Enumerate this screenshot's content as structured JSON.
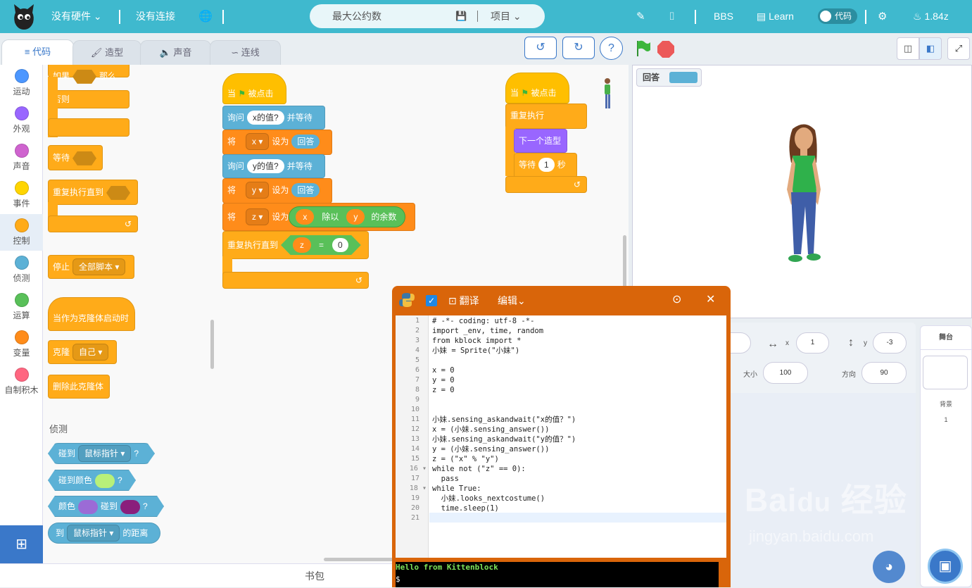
{
  "topbar": {
    "hardware": "没有硬件",
    "connection": "没有连接",
    "project_name": "最大公约数",
    "project_menu": "项目",
    "bbs": "BBS",
    "learn": "Learn",
    "code_toggle": "代码",
    "version": "1.84z"
  },
  "tabs": [
    "代码",
    "造型",
    "声音",
    "连线"
  ],
  "categories": [
    {
      "label": "运动",
      "color": "#4c97ff"
    },
    {
      "label": "外观",
      "color": "#9966ff"
    },
    {
      "label": "声音",
      "color": "#cf63cf"
    },
    {
      "label": "事件",
      "color": "#ffd500"
    },
    {
      "label": "控制",
      "color": "#ffab19"
    },
    {
      "label": "侦测",
      "color": "#5cb1d6"
    },
    {
      "label": "运算",
      "color": "#59c059"
    },
    {
      "label": "变量",
      "color": "#ff8c1a"
    },
    {
      "label": "自制积木",
      "color": "#ff6680"
    }
  ],
  "palette": {
    "if_then": "如果",
    "then": "那么",
    "else": "否则",
    "wait": "等待",
    "repeat_until": "重复执行直到",
    "stop": "停止",
    "stop_all": "全部脚本",
    "when_clone": "当作为克隆体启动时",
    "clone": "克隆",
    "clone_self": "自己",
    "delete_clone": "删除此克隆体",
    "sensing_header": "侦测",
    "touching": "碰到",
    "mouse_pointer": "鼠标指针",
    "touching_color": "碰到颜色",
    "color": "颜色",
    "touch": "碰到",
    "distance_to": "到",
    "distance": "的距离",
    "q": "?"
  },
  "script1": {
    "when": "当",
    "clicked": "被点击",
    "ask": "询问",
    "ask_x": "x的值?",
    "and_wait": "并等待",
    "set": "将",
    "var_x": "x",
    "set_to": "设为",
    "answer": "回答",
    "ask_y": "y的值?",
    "var_y": "y",
    "var_z": "z",
    "mod": "除以",
    "remainder": "的余数",
    "repeat_until": "重复执行直到",
    "eq": "=",
    "zero": "0"
  },
  "script2": {
    "when": "当",
    "clicked": "被点击",
    "forever": "重复执行",
    "next_costume": "下一个造型",
    "wait": "等待",
    "one": "1",
    "sec": "秒"
  },
  "stage": {
    "answer_monitor": "回答"
  },
  "sprite_info": {
    "x_label": "x",
    "x_value": "1",
    "y_label": "y",
    "y_value": "-3",
    "size_label": "大小",
    "size_value": "100",
    "direction_label": "方向",
    "direction_value": "90"
  },
  "stage_panel": {
    "title": "舞台",
    "backdrops": "背景",
    "count": "1"
  },
  "bottombar": {
    "backpack": "书包"
  },
  "python": {
    "translate": "翻译",
    "edit": "编辑",
    "lines": [
      "# -*- coding: utf-8 -*-",
      "import _env, time, random",
      "from kblock import *",
      "小妹 = Sprite(\"小妹\")",
      "",
      "x = 0",
      "y = 0",
      "z = 0",
      "",
      "",
      "小妹.sensing_askandwait(\"x的值？\")",
      "x = (小妹.sensing_answer())",
      "小妹.sensing_askandwait(\"y的值？\")",
      "y = (小妹.sensing_answer())",
      "z = (\"x\" % \"y\")",
      "while not (\"z\" == 0):",
      "  pass",
      "while True:",
      "  小妹.looks_nextcostume()",
      "  time.sleep(1)",
      ""
    ],
    "console_line": "Hello from Kittenblock",
    "prompt": "$"
  }
}
